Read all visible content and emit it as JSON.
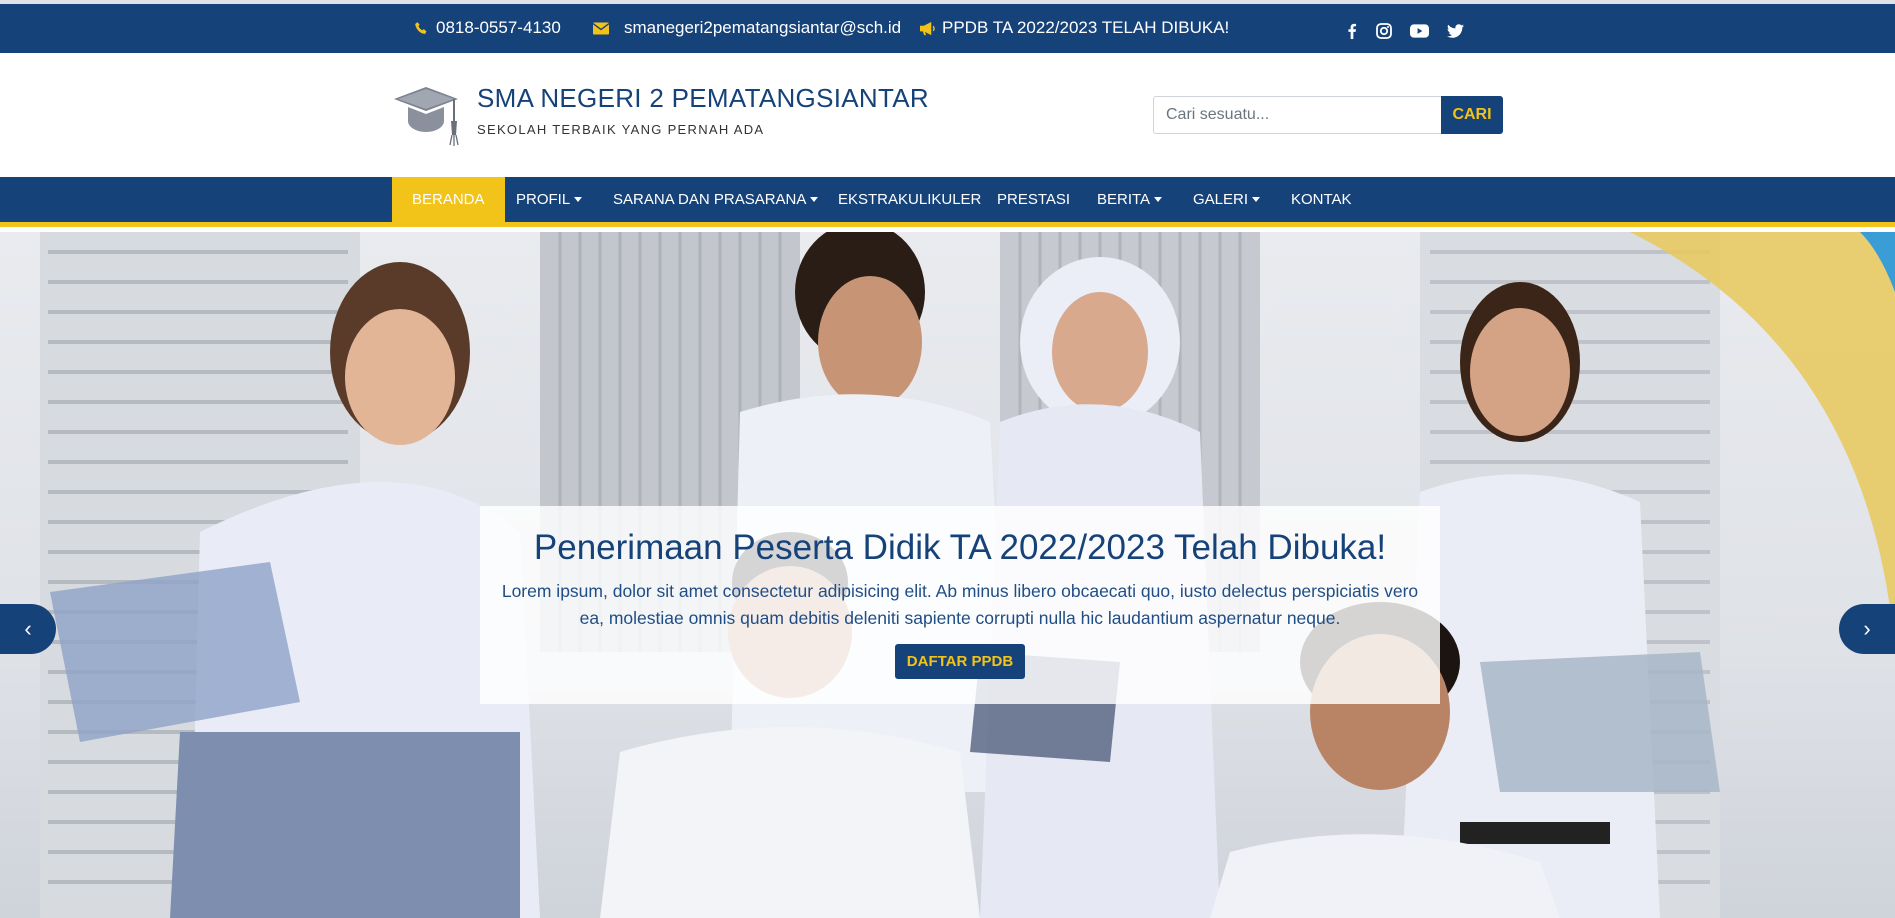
{
  "topbar": {
    "phone": "0818-0557-4130",
    "email": "smanegeri2pematangsiantar@sch.id",
    "announcement": "PPDB TA 2022/2023 TELAH DIBUKA!",
    "icons": [
      "phone-icon",
      "mail-icon",
      "megaphone-icon",
      "facebook-icon",
      "instagram-icon",
      "youtube-icon",
      "twitter-icon"
    ]
  },
  "header": {
    "title": "SMA NEGERI 2 PEMATANGSIANTAR",
    "subtitle": "SEKOLAH TERBAIK YANG PERNAH ADA",
    "search": {
      "placeholder": "Cari sesuatu...",
      "button": "CARI"
    }
  },
  "nav": {
    "items": [
      {
        "label": "BERANDA",
        "active": true
      },
      {
        "label": "PROFIL",
        "dropdown": true
      },
      {
        "label": "SARANA DAN PRASARANA",
        "dropdown": true
      },
      {
        "label": "EKSTRAKULIKULER"
      },
      {
        "label": "PRESTASI"
      },
      {
        "label": "BERITA",
        "dropdown": true
      },
      {
        "label": "GALERI",
        "dropdown": true
      },
      {
        "label": "KONTAK"
      }
    ]
  },
  "hero": {
    "heading": "Penerimaan Peserta Didik TA 2022/2023 Telah Dibuka!",
    "text": "Lorem ipsum, dolor sit amet consectetur adipisicing elit. Ab minus libero obcaecati quo, iusto delectus perspiciatis vero ea, molestiae omnis quam debitis deleniti sapiente corrupti nulla hic laudantium aspernatur neque.",
    "button": "DAFTAR PPDB",
    "prev": "‹",
    "next": "›"
  },
  "colors": {
    "primary": "#16427a",
    "accent": "#f2c318",
    "white": "#ffffff"
  }
}
